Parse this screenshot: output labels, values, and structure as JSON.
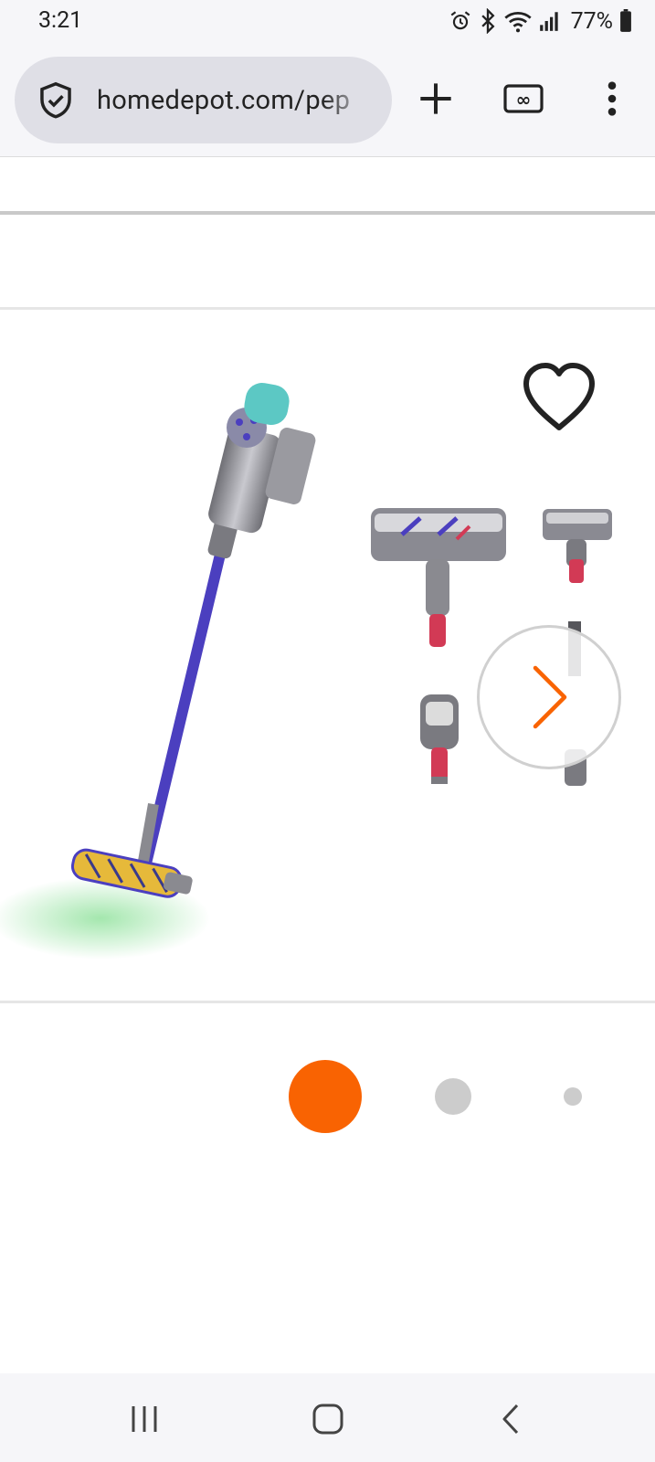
{
  "status_bar": {
    "time": "3:21",
    "battery": "77%",
    "icons": [
      "alarm-icon",
      "bluetooth-icon",
      "wifi-icon",
      "signal-icon",
      "battery-icon"
    ]
  },
  "browser": {
    "url": "homedepot.com/pep",
    "url_placeholder": "",
    "actions": [
      "new-tab-icon",
      "tab-switcher-icon",
      "more-menu-icon"
    ],
    "tab_switcher_label": "∞"
  },
  "product_gallery": {
    "image_alt": "Cordless stick vacuum with attachments",
    "wishlist_icon": "heart-outline-icon",
    "next_icon": "chevron-right-icon",
    "pagination": {
      "total_dots": 3,
      "active_index": 0
    }
  },
  "colors": {
    "accent": "#f96302",
    "vacuum_wand": "#4b3fbf",
    "vacuum_head": "#e6b93a",
    "bin_teal": "#5cc8c4"
  },
  "nav_bar": {
    "buttons": [
      "recents-icon",
      "home-icon",
      "back-icon"
    ]
  }
}
